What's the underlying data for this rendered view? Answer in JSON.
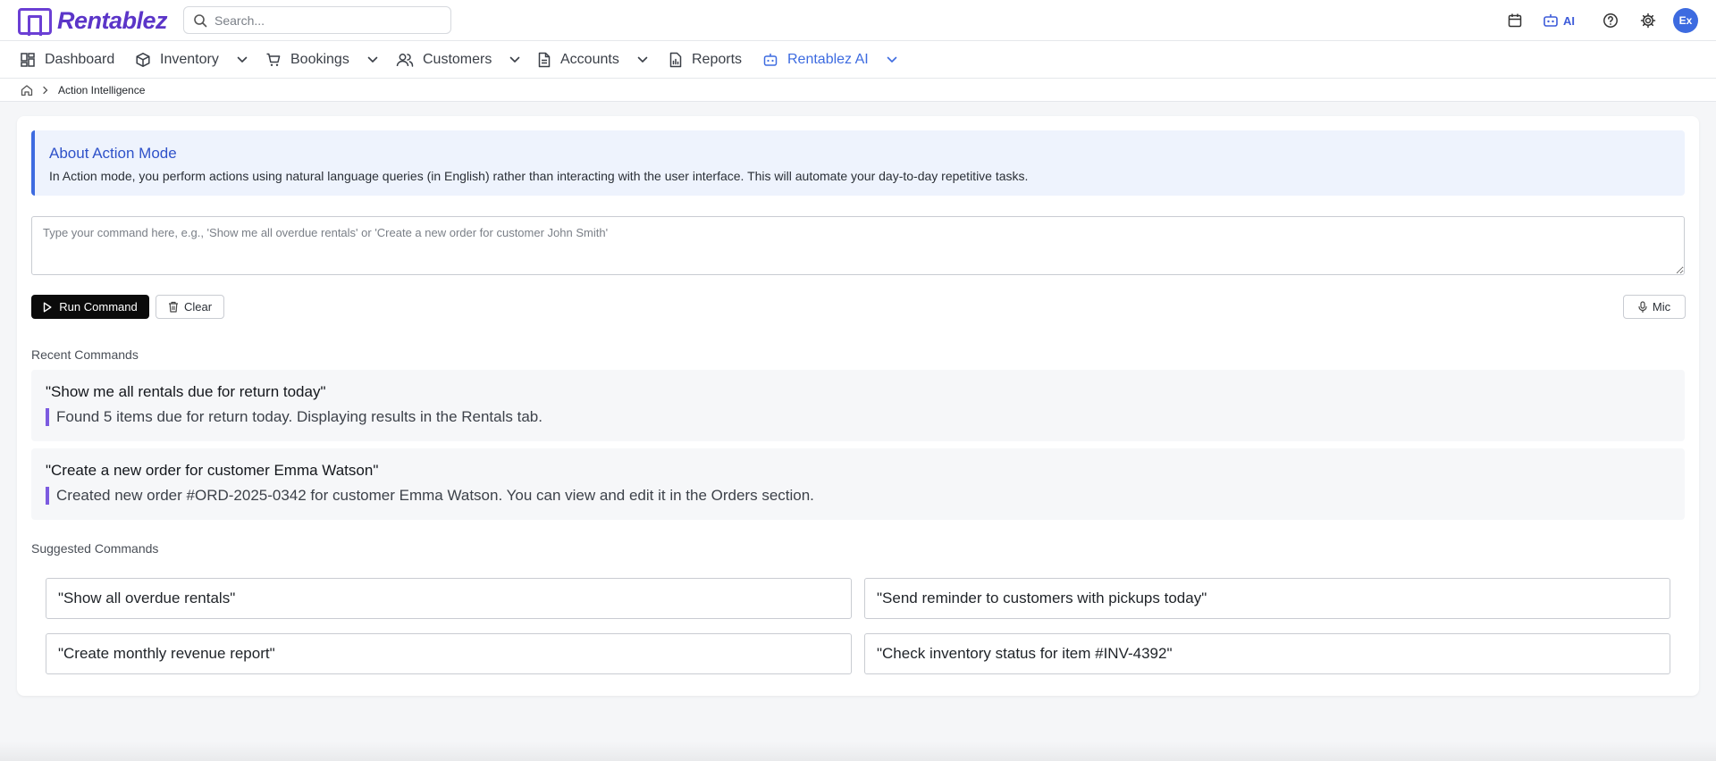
{
  "app": {
    "name": "Rentablez",
    "brand_color": "#5b35c8",
    "accent_color": "#3d6be0"
  },
  "header": {
    "search_placeholder": "Search...",
    "ai_label": "AI",
    "avatar_initials": "Ex",
    "icons": [
      "calendar-icon",
      "robot-icon",
      "help-icon",
      "gear-icon"
    ]
  },
  "nav": {
    "items": [
      {
        "label": "Dashboard",
        "icon": "dashboard-icon",
        "has_dropdown": false
      },
      {
        "label": "Inventory",
        "icon": "box-icon",
        "has_dropdown": true
      },
      {
        "label": "Bookings",
        "icon": "cart-icon",
        "has_dropdown": true
      },
      {
        "label": "Customers",
        "icon": "users-icon",
        "has_dropdown": true
      },
      {
        "label": "Accounts",
        "icon": "document-icon",
        "has_dropdown": true
      },
      {
        "label": "Reports",
        "icon": "report-icon",
        "has_dropdown": false
      },
      {
        "label": "Rentablez AI",
        "icon": "robot-icon",
        "has_dropdown": true,
        "active": true
      }
    ]
  },
  "breadcrumb": {
    "current": "Action Intelligence"
  },
  "about": {
    "title": "About Action Mode",
    "text": "In Action mode, you perform actions using natural language queries (in English) rather than interacting with the user interface. This will automate your day-to-day repetitive tasks."
  },
  "command": {
    "placeholder": "Type your command here, e.g., 'Show me all overdue rentals' or 'Create a new order for customer John Smith'",
    "value": "",
    "run_label": "Run Command",
    "clear_label": "Clear",
    "mic_label": "Mic"
  },
  "recent": {
    "title": "Recent Commands",
    "items": [
      {
        "query": "\"Show me all rentals due for return today\"",
        "response": "Found 5 items due for return today. Displaying results in the Rentals tab."
      },
      {
        "query": "\"Create a new order for customer Emma Watson\"",
        "response": "Created new order #ORD-2025-0342 for customer Emma Watson. You can view and edit it in the Orders section."
      }
    ]
  },
  "suggested": {
    "title": "Suggested Commands",
    "items": [
      "\"Show all overdue rentals\"",
      "\"Send reminder to customers with pickups today\"",
      "\"Create monthly revenue report\"",
      "\"Check inventory status for item #INV-4392\""
    ]
  }
}
